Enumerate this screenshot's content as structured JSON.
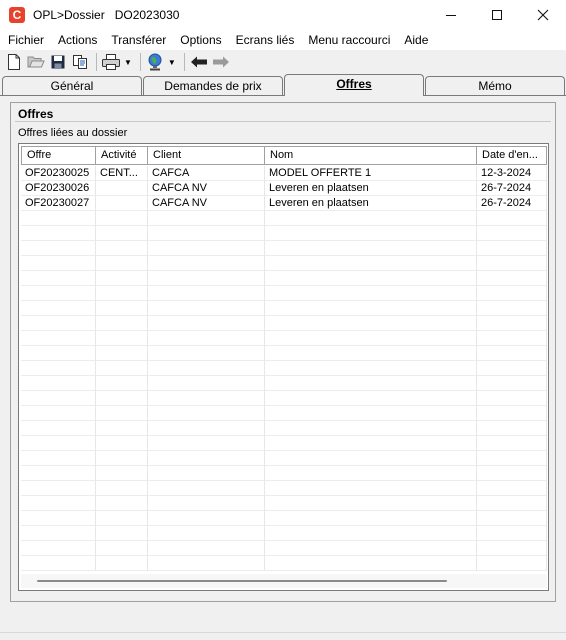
{
  "window": {
    "app": "OPL>Dossier",
    "document": "DO2023030",
    "app_icon_letter": "C"
  },
  "menu": [
    "Fichier",
    "Actions",
    "Transférer",
    "Options",
    "Ecrans liés",
    "Menu raccourci",
    "Aide"
  ],
  "toolbar": {
    "icons": [
      "new-document-icon",
      "open-folder-icon",
      "save-icon",
      "copy-icon",
      "print-icon",
      "globe-icon",
      "back-arrow-icon",
      "forward-arrow-icon"
    ]
  },
  "tabs": {
    "general": "Général",
    "demandes": "Demandes de prix",
    "offres": "Offres",
    "memo": "Mémo",
    "active": "offres"
  },
  "section": {
    "title": "Offres",
    "list_label": "Offres liées au dossier"
  },
  "table": {
    "columns": [
      "Offre",
      "Activité",
      "Client",
      "Nom",
      "Date d'en..."
    ],
    "rows": [
      [
        "OF20230025",
        "CENT...",
        "CAFCA",
        "MODEL OFFERTE 1",
        "12-3-2024"
      ],
      [
        "OF20230026",
        "",
        "CAFCA NV",
        "Leveren en plaatsen",
        "26-7-2024"
      ],
      [
        "OF20230027",
        "",
        "CAFCA NV",
        "Leveren en plaatsen",
        "26-7-2024"
      ]
    ]
  },
  "colors": {
    "accent": "#e8412c",
    "background": "#f0f0f0"
  }
}
